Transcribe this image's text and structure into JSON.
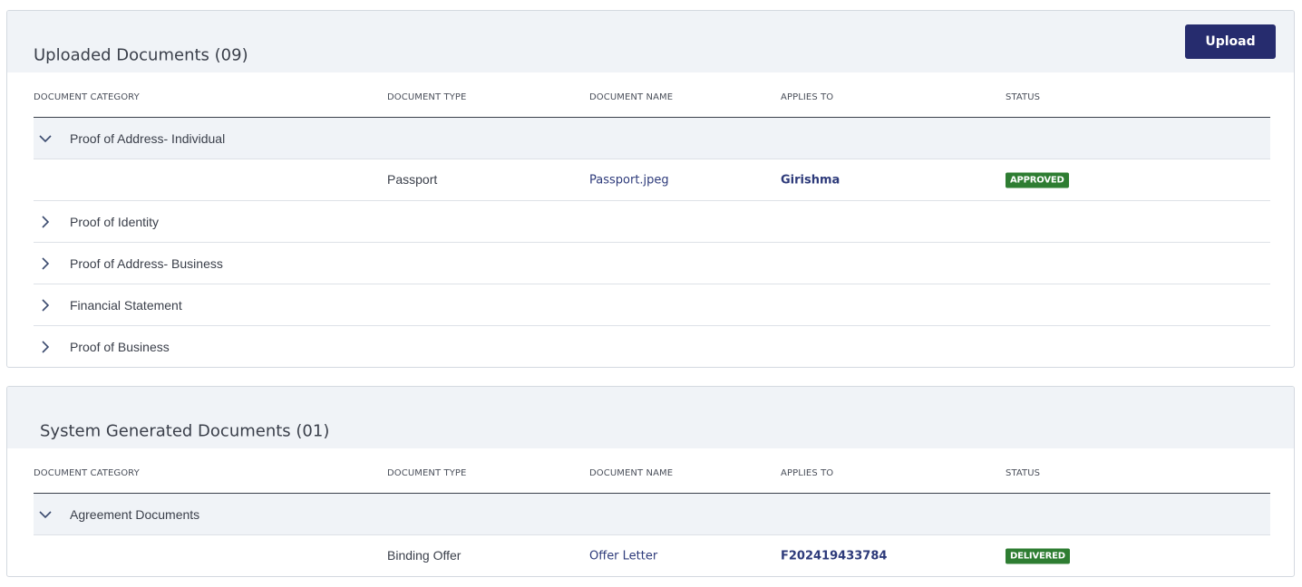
{
  "uploaded": {
    "title": "Uploaded Documents (09)",
    "upload_label": "Upload",
    "columns": [
      "DOCUMENT CATEGORY",
      "DOCUMENT TYPE",
      "DOCUMENT NAME",
      "APPLIES TO",
      "STATUS"
    ],
    "groups": [
      {
        "label": "Proof of Address- Individual",
        "expanded": true,
        "rows": [
          {
            "type": "Passport",
            "name": "Passport.jpeg",
            "applies_to": "Girishma",
            "status": "APPROVED"
          }
        ]
      },
      {
        "label": "Proof of Identity",
        "expanded": false
      },
      {
        "label": "Proof of Address- Business",
        "expanded": false
      },
      {
        "label": "Financial Statement",
        "expanded": false
      },
      {
        "label": "Proof of Business",
        "expanded": false
      }
    ]
  },
  "system": {
    "title": "System Generated Documents (01)",
    "columns": [
      "DOCUMENT CATEGORY",
      "DOCUMENT TYPE",
      "DOCUMENT NAME",
      "APPLIES TO",
      "STATUS"
    ],
    "groups": [
      {
        "label": "Agreement Documents",
        "expanded": true,
        "rows": [
          {
            "type": "Binding Offer",
            "name": "Offer Letter",
            "applies_to": "F202419433784",
            "status": "DELIVERED"
          }
        ]
      }
    ]
  },
  "colors": {
    "primary": "#262c6e",
    "status_green": "#2e7d32",
    "header_bg": "#f0f3f7",
    "link": "#2d3a7a"
  },
  "icons": {
    "expanded": "chevron-down-icon",
    "collapsed": "chevron-right-icon"
  }
}
